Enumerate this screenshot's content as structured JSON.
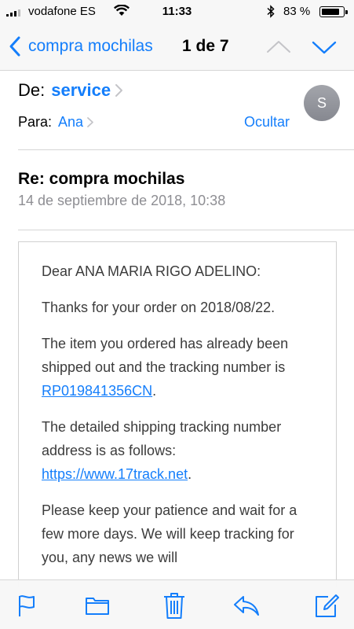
{
  "status_bar": {
    "carrier": "vodafone ES",
    "time": "11:33",
    "battery": "83 %",
    "battery_level": 0.83
  },
  "nav": {
    "back_label": "compra mochilas",
    "counter": "1 de 7"
  },
  "header": {
    "from_label": "De:",
    "from_name": "service",
    "to_label": "Para:",
    "to_name": "Ana",
    "hide_label": "Ocultar",
    "avatar_initial": "S",
    "subject": "Re: compra mochilas",
    "date": "14 de septiembre de 2018, 10:38"
  },
  "body": {
    "greeting": "Dear ANA MARIA RIGO ADELINO:",
    "thanks": "Thanks for your order on 2018/08/22.",
    "shipped_text": "The item you ordered has already been shipped out and the tracking number is ",
    "tracking_number": "RP019841356CN",
    "shipped_end": ".",
    "address_text": "The detailed shipping tracking number address is as follows: ",
    "tracking_url": "https://www.17track.net",
    "address_end": ".",
    "patience_text": "Please keep your patience and wait for a few more days. We will keep tracking for you, any news we will"
  },
  "colors": {
    "accent": "#147efb",
    "secondary_text": "#8e8e93",
    "body_text": "#3c3c3c"
  },
  "toolbar": {
    "icons": [
      "flag-icon",
      "folder-icon",
      "trash-icon",
      "reply-icon",
      "compose-icon"
    ]
  }
}
